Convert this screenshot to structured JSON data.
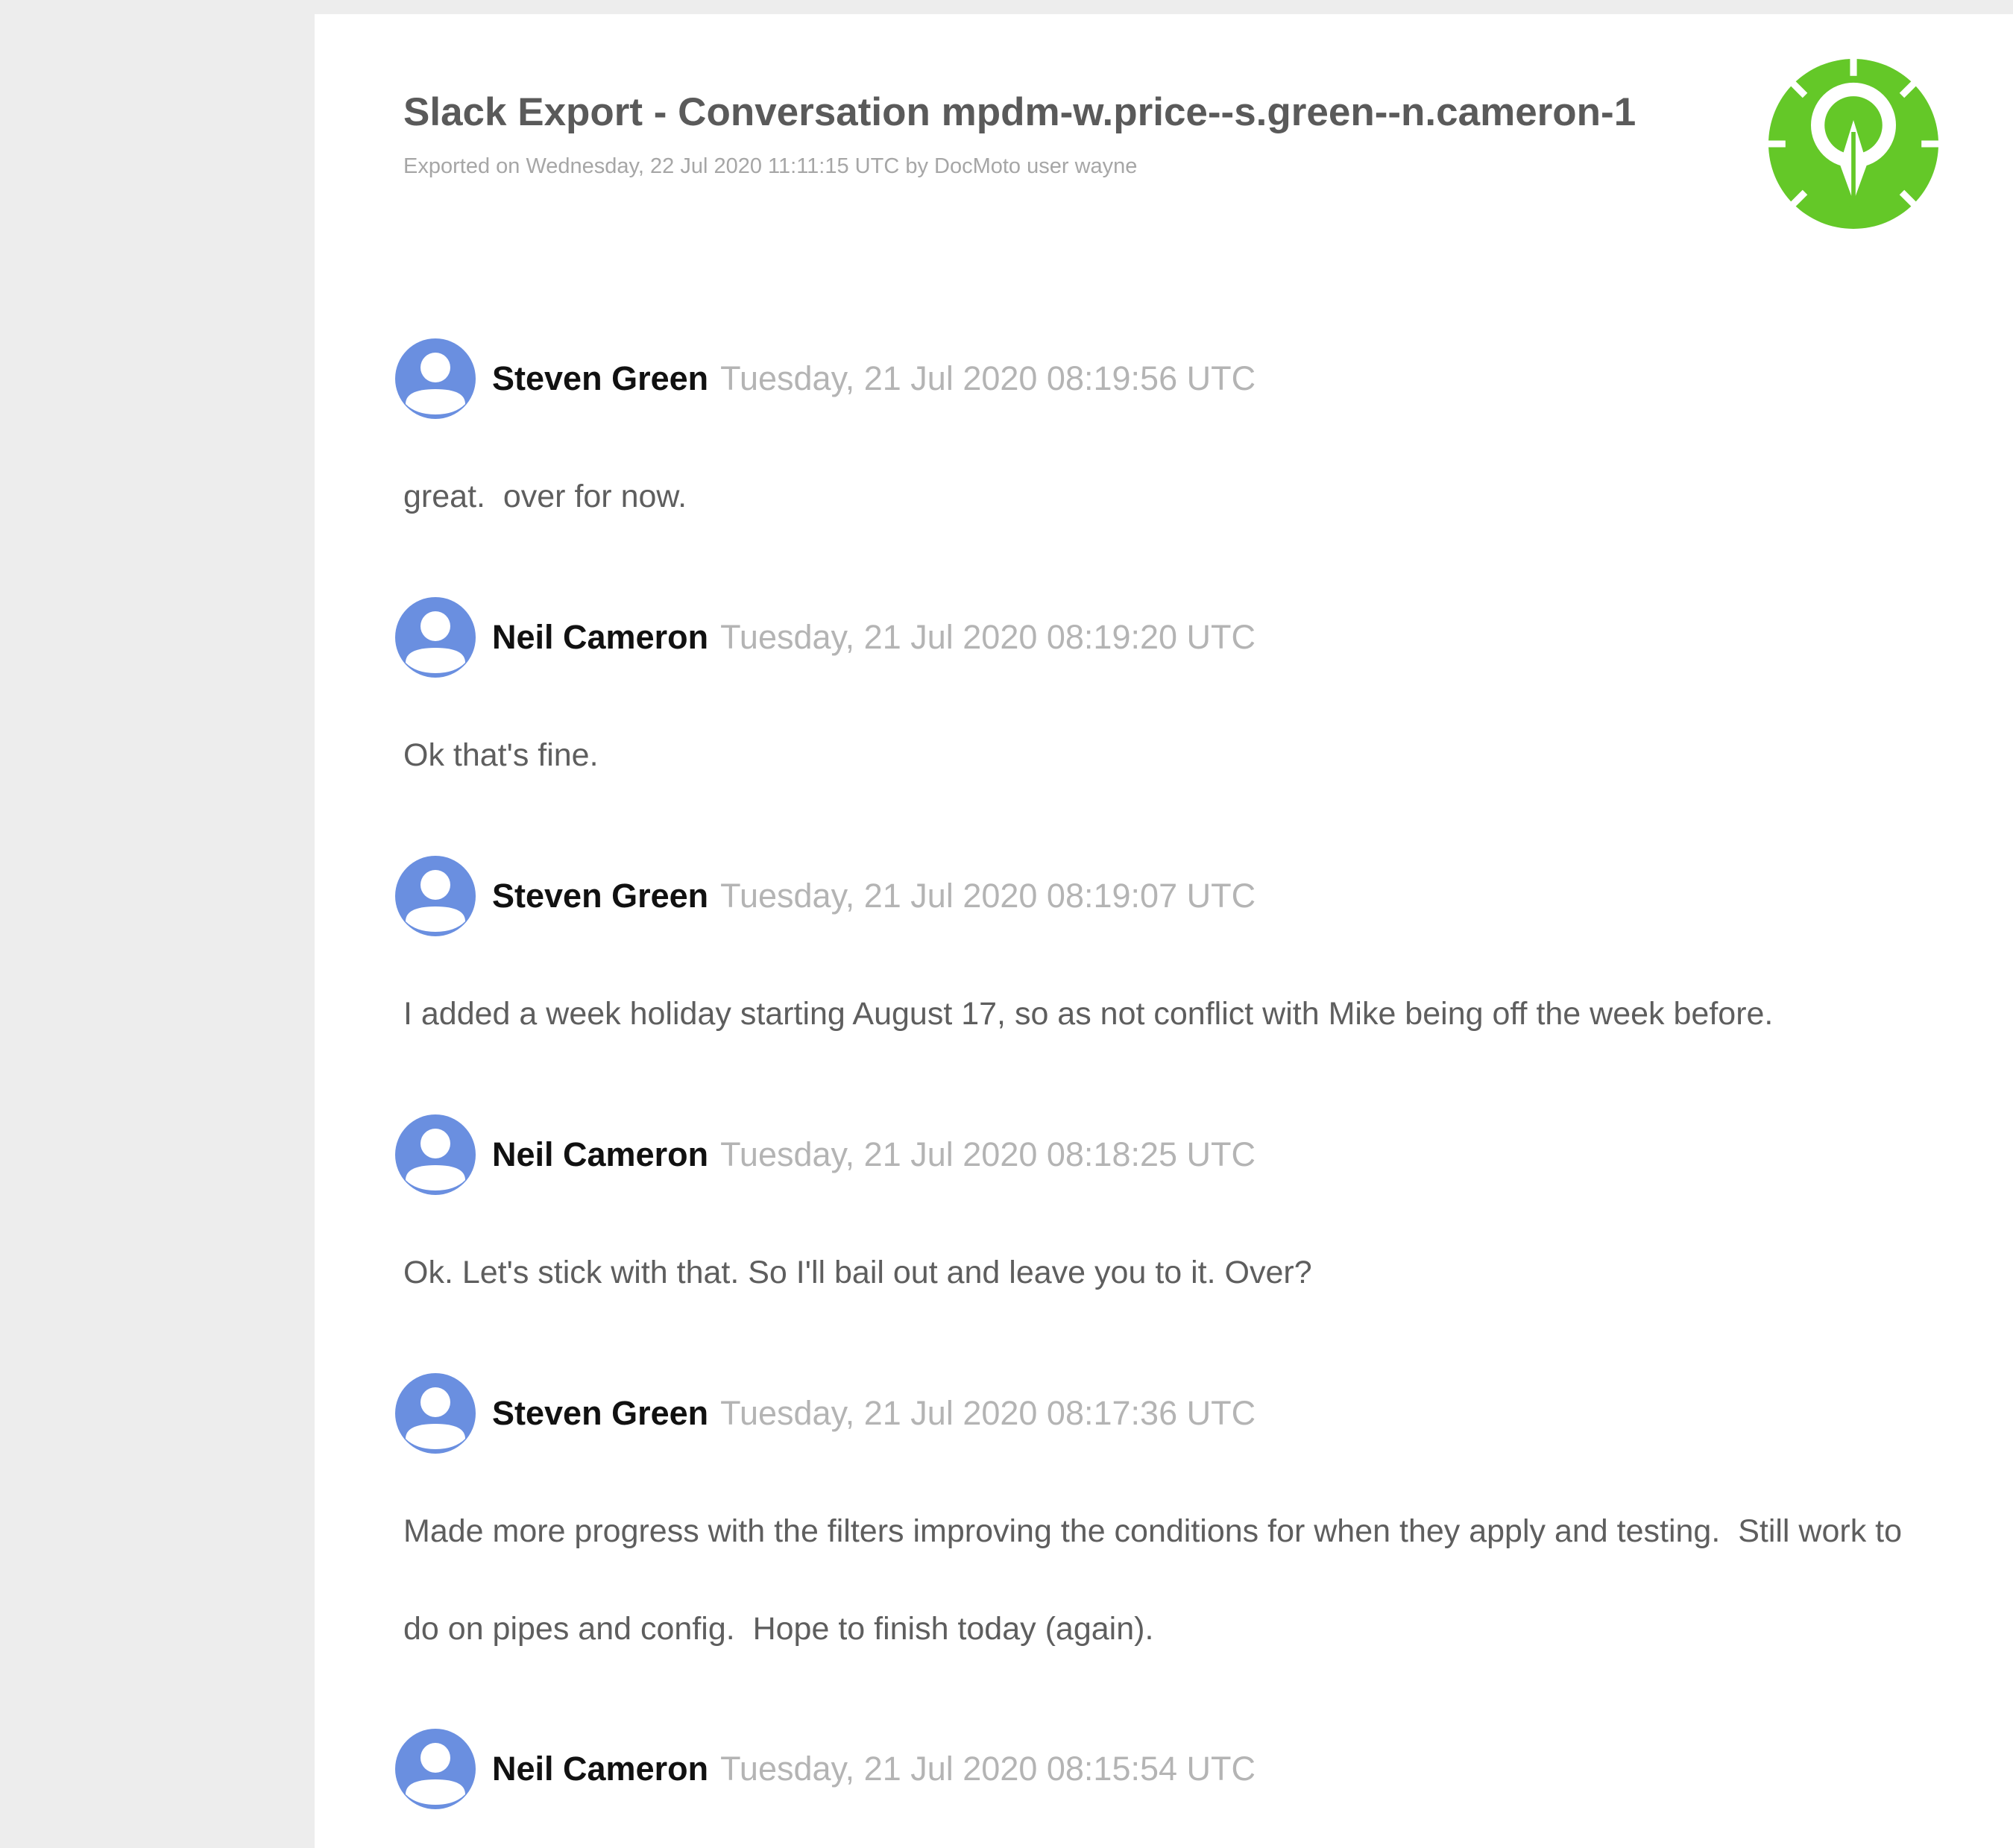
{
  "header": {
    "title": "Slack Export - Conversation mpdm-w.price--s.green--n.cameron-1",
    "subtitle": "Exported on Wednesday, 22 Jul 2020 11:11:15 UTC by DocMoto user wayne",
    "logo_icon": "docmoto-pen-nib-gear-icon"
  },
  "colors": {
    "logo_green": "#64c828",
    "avatar_blue": "#6a8fe0",
    "author_text": "#111111",
    "timestamp_text": "#b4b4b4",
    "body_text": "#5e5e5e",
    "background": "#ededed"
  },
  "messages": [
    {
      "author": "Steven Green",
      "timestamp": "Tuesday, 21 Jul 2020 08:19:56 UTC",
      "text": "great.  over for now.",
      "avatar_icon": "user-avatar-icon"
    },
    {
      "author": "Neil Cameron",
      "timestamp": "Tuesday, 21 Jul 2020 08:19:20 UTC",
      "text": "Ok that's fine.",
      "avatar_icon": "user-avatar-icon"
    },
    {
      "author": "Steven Green",
      "timestamp": "Tuesday, 21 Jul 2020 08:19:07 UTC",
      "text": "I added a week holiday starting August 17, so as not conflict with Mike being off the week before.",
      "avatar_icon": "user-avatar-icon"
    },
    {
      "author": "Neil Cameron",
      "timestamp": "Tuesday, 21 Jul 2020 08:18:25 UTC",
      "text": "Ok. Let's stick with that. So I'll bail out and leave you to it. Over?",
      "avatar_icon": "user-avatar-icon"
    },
    {
      "author": "Steven Green",
      "timestamp": "Tuesday, 21 Jul 2020 08:17:36 UTC",
      "text": "Made more progress with the filters improving the conditions for when they apply and testing.  Still work to do on pipes and config.  Hope to finish today (again).",
      "avatar_icon": "user-avatar-icon"
    },
    {
      "author": "Neil Cameron",
      "timestamp": "Tuesday, 21 Jul 2020 08:15:54 UTC",
      "text": "",
      "avatar_icon": "user-avatar-icon"
    }
  ]
}
